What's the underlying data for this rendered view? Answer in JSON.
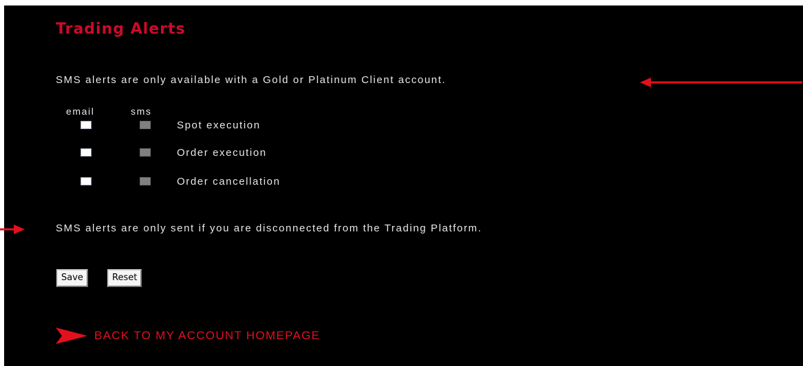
{
  "page": {
    "title": "Trading Alerts",
    "sms_availability_notice": "SMS alerts are only available with a Gold or Platinum Client account.",
    "sms_disconnect_notice": "SMS alerts are only sent if you are disconnected from the Trading Platform."
  },
  "alerts": {
    "column_headers": {
      "email": "email",
      "sms": "sms"
    },
    "rows": [
      {
        "label": "Spot execution",
        "email_checked": false,
        "sms_enabled": false
      },
      {
        "label": "Order execution",
        "email_checked": false,
        "sms_enabled": false
      },
      {
        "label": "Order cancellation",
        "email_checked": false,
        "sms_enabled": false
      }
    ]
  },
  "form": {
    "save_label": "Save",
    "reset_label": "Reset"
  },
  "nav": {
    "back_link_label": "BACK TO MY ACCOUNT HOMEPAGE",
    "back_link_icon": "arrow-pointer-icon"
  },
  "annotations": {
    "arrow_icon": "red-arrow-icon"
  },
  "colors": {
    "background": "#000000",
    "title": "#cc0a2a",
    "link": "#e3101e",
    "text": "#e8e8e8",
    "annotation_arrow": "#e3101e",
    "sms_checkbox_disabled": "#808080"
  }
}
